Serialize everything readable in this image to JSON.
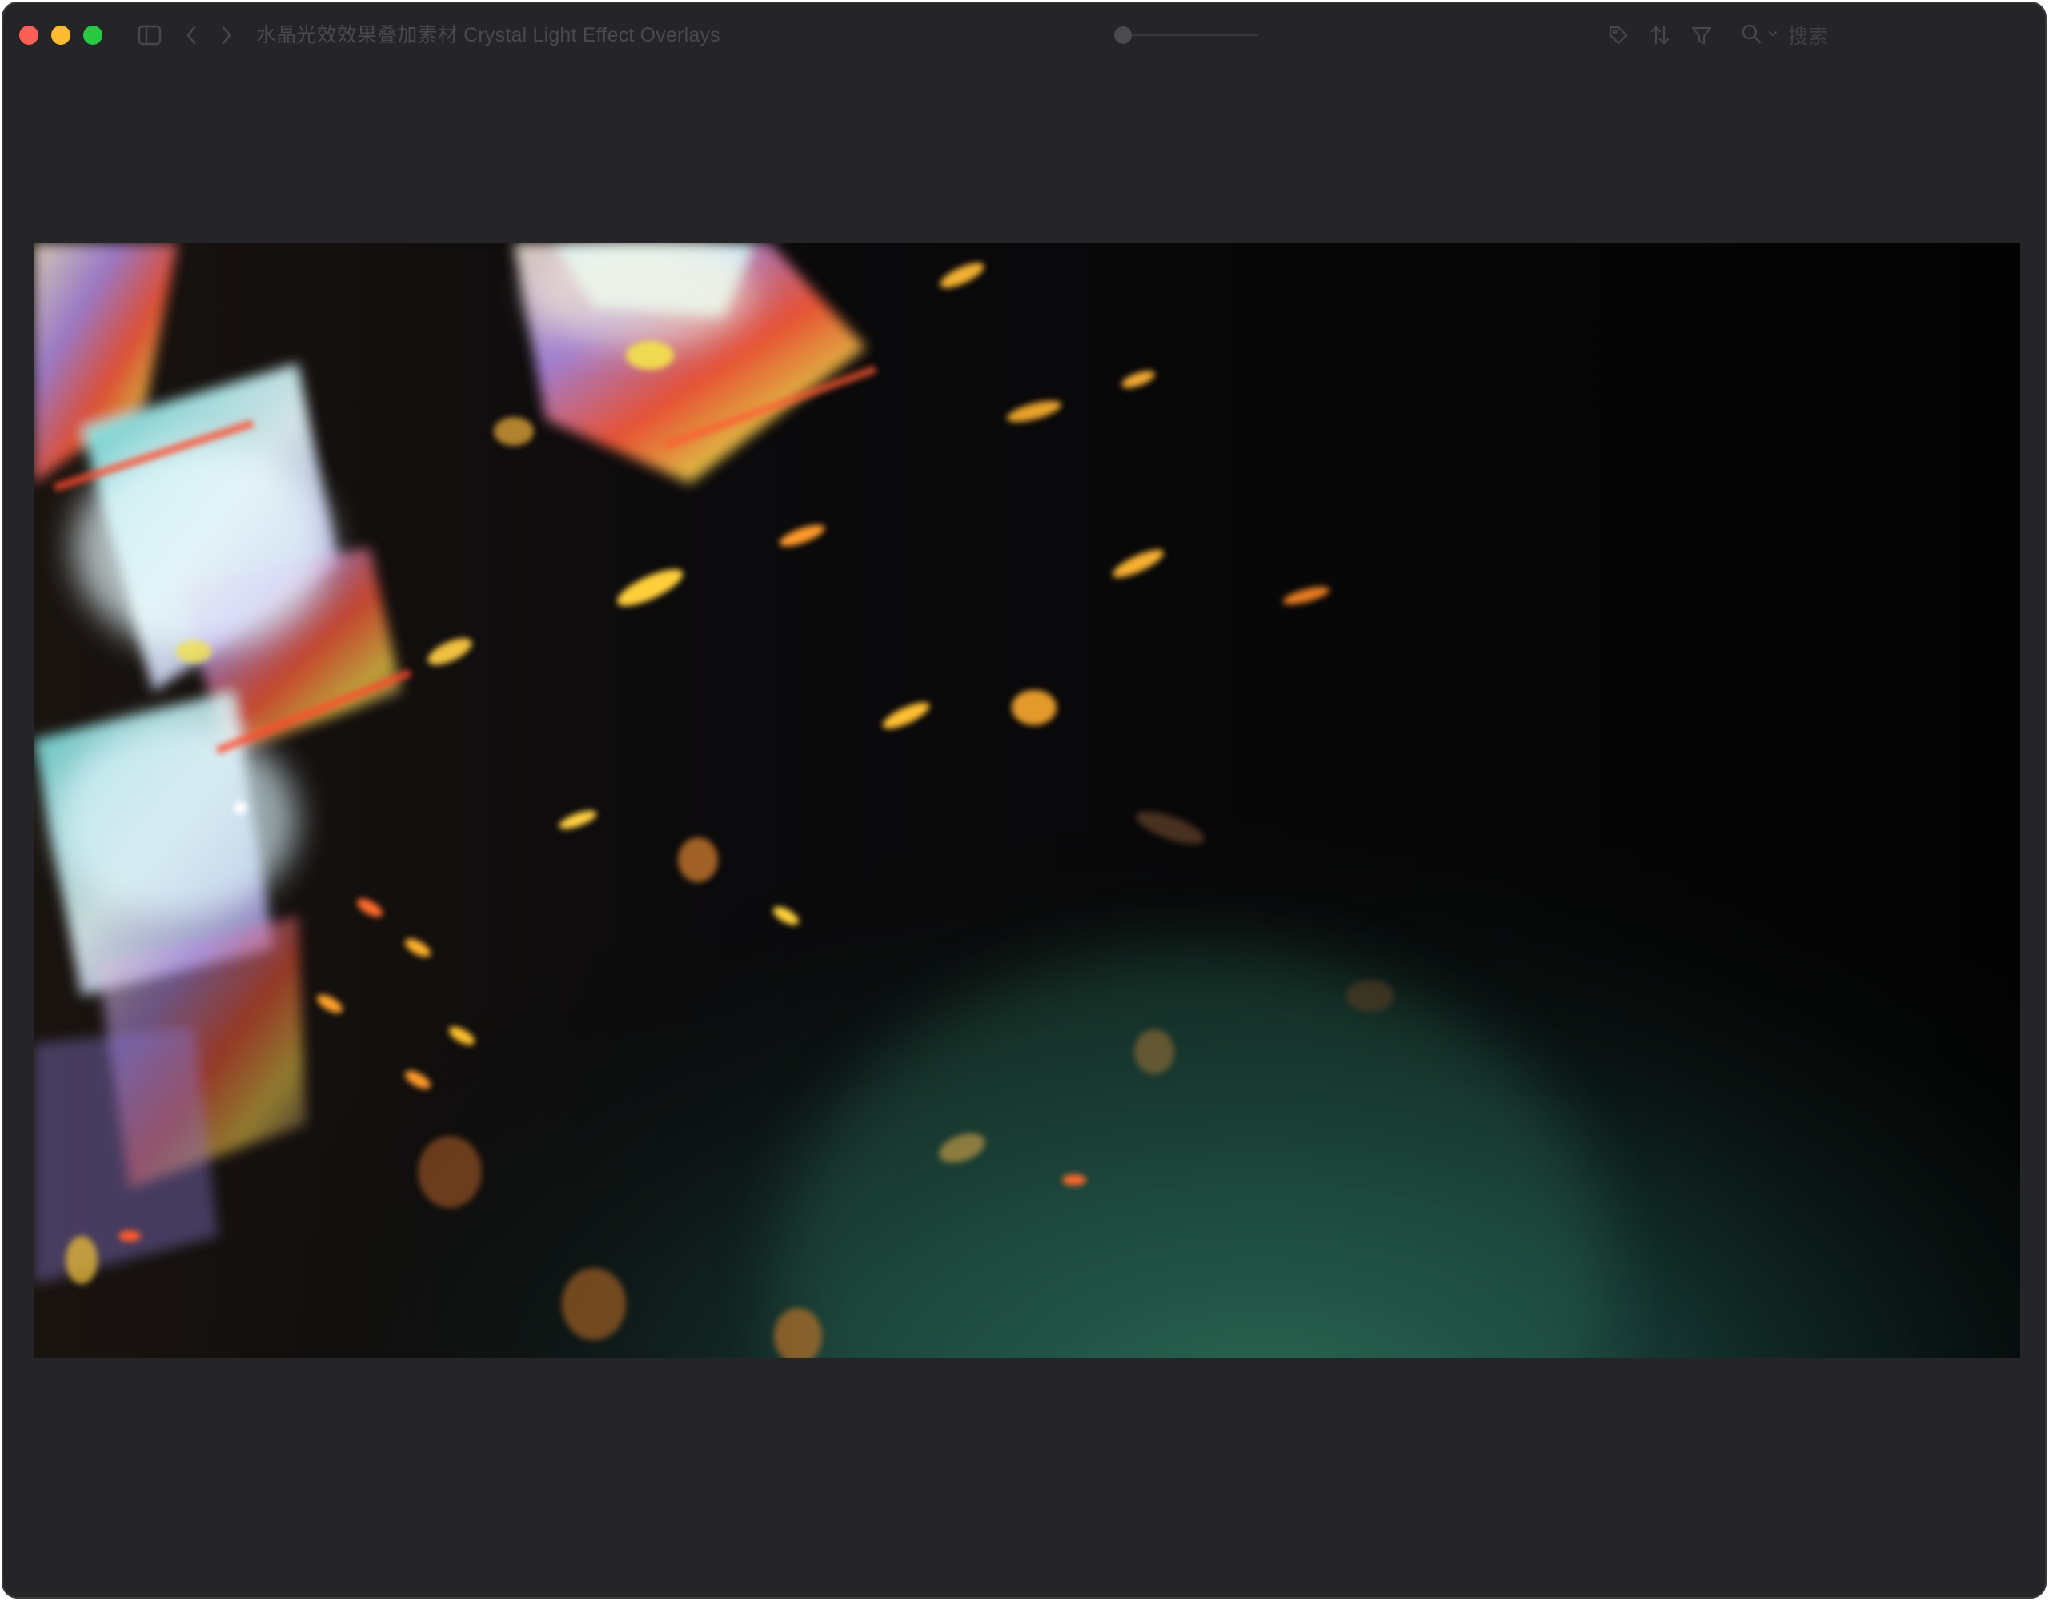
{
  "window": {
    "title": "水晶光效效果叠加素材 Crystal Light Effect Overlays"
  },
  "toolbar": {
    "sidebar_icon": "sidebar-icon",
    "back_icon": "chevron-left-icon",
    "forward_icon": "chevron-right-icon",
    "tag_icon": "tag-icon",
    "sort_icon": "sort-icon",
    "filter_icon": "filter-icon",
    "search_icon": "search-icon",
    "search_placeholder": "搜索"
  },
  "preview": {
    "description_icon": "image-preview"
  },
  "colors": {
    "window_bg": "#252527",
    "close": "#ff5f57",
    "minimize": "#febc2e",
    "zoom": "#28c840"
  }
}
